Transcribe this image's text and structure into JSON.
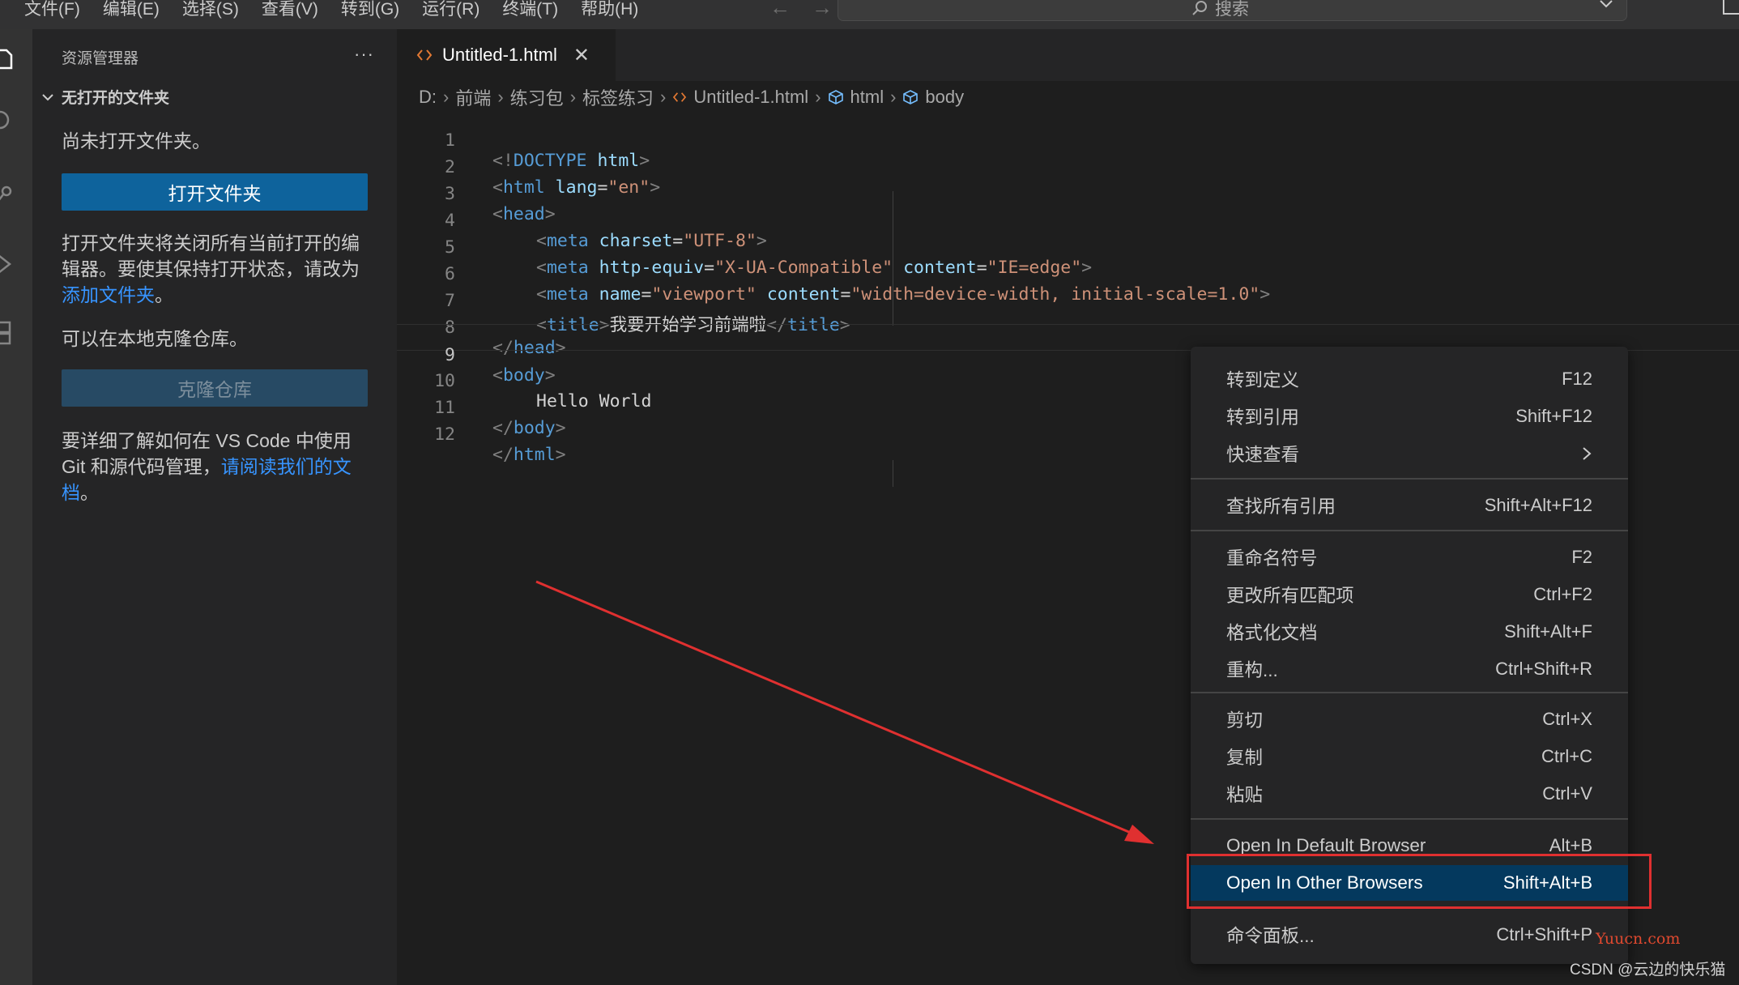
{
  "menubar": {
    "items": [
      "文件(F)",
      "编辑(E)",
      "选择(S)",
      "查看(V)",
      "转到(G)",
      "运行(R)",
      "终端(T)",
      "帮助(H)"
    ],
    "search_placeholder": "搜索"
  },
  "sidebar": {
    "title": "资源管理器",
    "more": "···",
    "section": "无打开的文件夹",
    "no_folder_text": "尚未打开文件夹。",
    "open_folder_button": "打开文件夹",
    "close_editors_text": "打开文件夹将关闭所有当前打开的编辑器。要使其保持打开状态，请改为",
    "add_folder_link": "添加文件夹",
    "period1": "。",
    "clone_text": "可以在本地克隆仓库。",
    "clone_button": "克隆仓库",
    "learn_text": "要详细了解如何在 VS Code 中使用 Git 和源代码管理，",
    "docs_link": "请阅读我们的文档",
    "period2": "。"
  },
  "tab": {
    "label": "Untitled-1.html",
    "close": "✕"
  },
  "breadcrumb": {
    "items": [
      "D:",
      "前端",
      "练习包",
      "标签练习",
      "Untitled-1.html",
      "html",
      "body"
    ]
  },
  "code": {
    "line_numbers": [
      "1",
      "2",
      "3",
      "4",
      "5",
      "6",
      "7",
      "8",
      "9",
      "10",
      "11",
      "12"
    ],
    "active_line": "9",
    "l1": [
      "<!",
      "DOCTYPE",
      " html",
      ">"
    ],
    "l2": [
      "<",
      "html",
      " lang",
      "=",
      "\"en\"",
      ">"
    ],
    "l3": [
      "<",
      "head",
      ">"
    ],
    "l4": [
      "<",
      "meta",
      " charset",
      "=",
      "\"UTF-8\"",
      ">"
    ],
    "l5": [
      "<",
      "meta",
      " http-equiv",
      "=",
      "\"X-UA-Compatible\"",
      " content",
      "=",
      "\"IE=edge\"",
      ">"
    ],
    "l6": [
      "<",
      "meta",
      " name",
      "=",
      "\"viewport\"",
      " content",
      "=",
      "\"width=device-width, initial-scale=1.0\"",
      ">"
    ],
    "l7": [
      "<",
      "title",
      ">",
      "我要开始学习前端啦",
      "</",
      "title",
      ">"
    ],
    "l8": [
      "</",
      "head",
      ">"
    ],
    "l9": [
      "<",
      "body",
      ">"
    ],
    "l10": "Hello World",
    "l11": [
      "</",
      "body",
      ">"
    ],
    "l12": [
      "</",
      "html",
      ">"
    ]
  },
  "context_menu": {
    "items": [
      {
        "label": "转到定义",
        "shortcut": "F12"
      },
      {
        "label": "转到引用",
        "shortcut": "Shift+F12"
      },
      {
        "label": "快速查看",
        "shortcut": ""
      },
      {
        "label": "查找所有引用",
        "shortcut": "Shift+Alt+F12"
      },
      {
        "label": "重命名符号",
        "shortcut": "F2"
      },
      {
        "label": "更改所有匹配项",
        "shortcut": "Ctrl+F2"
      },
      {
        "label": "格式化文档",
        "shortcut": "Shift+Alt+F"
      },
      {
        "label": "重构...",
        "shortcut": "Ctrl+Shift+R"
      },
      {
        "label": "剪切",
        "shortcut": "Ctrl+X"
      },
      {
        "label": "复制",
        "shortcut": "Ctrl+C"
      },
      {
        "label": "粘贴",
        "shortcut": "Ctrl+V"
      },
      {
        "label": "Open In Default Browser",
        "shortcut": "Alt+B"
      },
      {
        "label": "Open In Other Browsers",
        "shortcut": "Shift+Alt+B"
      },
      {
        "label": "命令面板...",
        "shortcut": "Ctrl+Shift+P"
      }
    ],
    "highlighted_index": 12
  },
  "watermarks": {
    "yuucn": "Yuucn.com",
    "csdn": "CSDN @云边的快乐猫"
  },
  "colors": {
    "accent_button": "#0e639c",
    "menu_highlight": "#04395e",
    "annotation_red": "#e03030",
    "link": "#3794ff"
  }
}
